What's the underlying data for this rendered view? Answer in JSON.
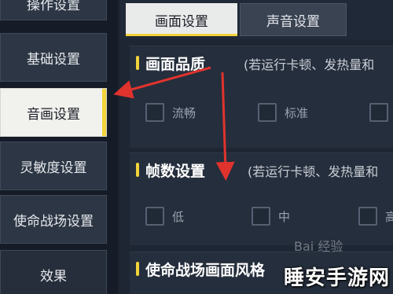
{
  "sidebar": {
    "items": [
      {
        "label": "操作设置"
      },
      {
        "label": "基础设置"
      },
      {
        "label": "音画设置"
      },
      {
        "label": "灵敏度设置"
      },
      {
        "label": "使命战场设置"
      },
      {
        "label": "效果"
      }
    ],
    "active_index": 2
  },
  "tabs": [
    {
      "label": "画面设置",
      "active": true
    },
    {
      "label": "声音设置",
      "active": false
    }
  ],
  "sections": {
    "quality": {
      "title": "画面品质",
      "note": "(若运行卡顿、发热量和",
      "options": [
        "流畅",
        "标准",
        ""
      ]
    },
    "fps": {
      "title": "帧数设置",
      "note": "(若运行卡顿、发热量和",
      "options": [
        "低",
        "中",
        "高"
      ]
    },
    "style": {
      "title": "使命战场画面风格"
    }
  },
  "watermark": {
    "baidu": "Bai 经验",
    "site": "睡安手游网"
  },
  "colors": {
    "accent_yellow": "#f2d33a",
    "arrow_red": "#e0332e",
    "active_bg": "#f1f1ee"
  }
}
